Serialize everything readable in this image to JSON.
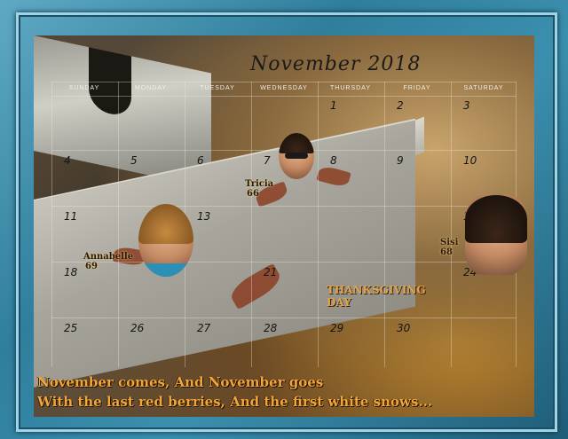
{
  "calendar": {
    "title": "November 2018",
    "days": [
      "SUNDAY",
      "MONDAY",
      "TUESDAY",
      "WEDNESDAY",
      "THURSDAY",
      "FRIDAY",
      "SATURDAY"
    ],
    "dates": [
      {
        "n": "1",
        "col": 4,
        "row": 0
      },
      {
        "n": "2",
        "col": 5,
        "row": 0
      },
      {
        "n": "3",
        "col": 6,
        "row": 0
      },
      {
        "n": "4",
        "col": 0,
        "row": 1
      },
      {
        "n": "5",
        "col": 1,
        "row": 1
      },
      {
        "n": "6",
        "col": 2,
        "row": 1
      },
      {
        "n": "7",
        "col": 3,
        "row": 1
      },
      {
        "n": "8",
        "col": 4,
        "row": 1
      },
      {
        "n": "9",
        "col": 5,
        "row": 1
      },
      {
        "n": "10",
        "col": 6,
        "row": 1
      },
      {
        "n": "11",
        "col": 0,
        "row": 2
      },
      {
        "n": "13",
        "col": 2,
        "row": 2
      },
      {
        "n": "17",
        "col": 6,
        "row": 2
      },
      {
        "n": "18",
        "col": 0,
        "row": 3
      },
      {
        "n": "21",
        "col": 3,
        "row": 3
      },
      {
        "n": "24",
        "col": 6,
        "row": 3
      },
      {
        "n": "25",
        "col": 0,
        "row": 4
      },
      {
        "n": "26",
        "col": 1,
        "row": 4
      },
      {
        "n": "27",
        "col": 2,
        "row": 4
      },
      {
        "n": "28",
        "col": 3,
        "row": 4
      },
      {
        "n": "29",
        "col": 4,
        "row": 4
      },
      {
        "n": "30",
        "col": 5,
        "row": 4
      }
    ]
  },
  "people": [
    {
      "name": "Tricia",
      "age": "66"
    },
    {
      "name": "Annabelle",
      "age": "69"
    },
    {
      "name": "Sisi",
      "age": "68"
    }
  ],
  "holiday": {
    "line1": "THANKSGIVING",
    "line2": "DAY"
  },
  "poem": {
    "line1": "November comes, And November goes",
    "line2": "With the last red berries, And the first white snows..."
  },
  "colors": {
    "frame": "#3b8fae",
    "poem_text": "#f1a63b",
    "holiday_text": "#e2a24a"
  }
}
